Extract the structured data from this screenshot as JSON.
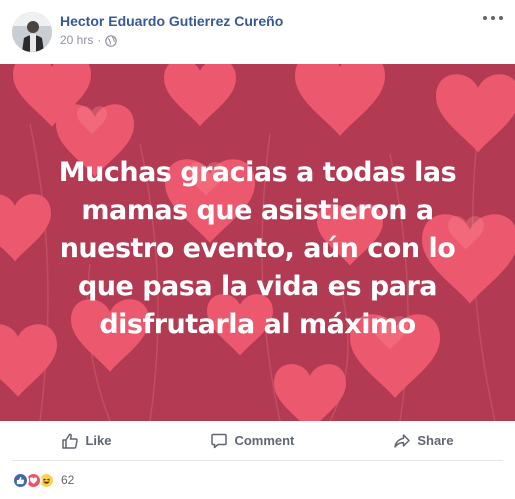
{
  "post": {
    "author": "Hector Eduardo Gutierrez Cureño",
    "timestamp": "20 hrs",
    "separator": "·",
    "privacy_icon": "globe-icon",
    "menu_icon": "more-options-icon"
  },
  "image": {
    "text": "Muchas gracias a todas las mamas que asistieron a nuestro evento, aún con lo que pasa la vida es para disfrutarla al máximo",
    "background_color": "#b23a52",
    "heart_color": "#f0566a"
  },
  "actions": {
    "like_label": "Like",
    "comment_label": "Comment",
    "share_label": "Share"
  },
  "reactions": {
    "types": [
      "like-icon",
      "love-icon",
      "haha-icon"
    ],
    "count": "62"
  },
  "colors": {
    "link_blue": "#385898",
    "meta_gray": "#90949c",
    "action_gray": "#606770"
  }
}
